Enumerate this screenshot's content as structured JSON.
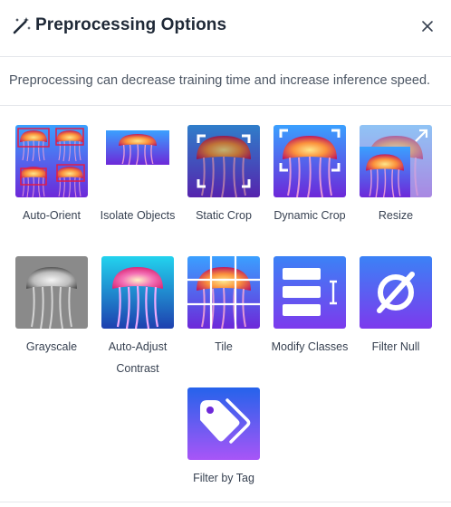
{
  "dialog": {
    "title": "Preprocessing Options",
    "subtitle": "Preprocessing can decrease training time and increase inference speed."
  },
  "options": [
    {
      "id": "auto-orient",
      "label": "Auto-Orient",
      "icon": "auto-orient-thumbnail"
    },
    {
      "id": "isolate-objects",
      "label": "Isolate Objects",
      "icon": "isolate-objects-thumbnail"
    },
    {
      "id": "static-crop",
      "label": "Static Crop",
      "icon": "static-crop-thumbnail"
    },
    {
      "id": "dynamic-crop",
      "label": "Dynamic Crop",
      "icon": "dynamic-crop-thumbnail"
    },
    {
      "id": "resize",
      "label": "Resize",
      "icon": "resize-thumbnail"
    },
    {
      "id": "grayscale",
      "label": "Grayscale",
      "icon": "grayscale-thumbnail"
    },
    {
      "id": "auto-adjust-contrast",
      "label": "Auto-Adjust Contrast",
      "icon": "auto-adjust-contrast-thumbnail"
    },
    {
      "id": "tile",
      "label": "Tile",
      "icon": "tile-thumbnail"
    },
    {
      "id": "modify-classes",
      "label": "Modify Classes",
      "icon": "modify-classes-icon"
    },
    {
      "id": "filter-null",
      "label": "Filter Null",
      "icon": "filter-null-icon"
    },
    {
      "id": "filter-by-tag",
      "label": "Filter by Tag",
      "icon": "tag-icon"
    }
  ],
  "colors": {
    "accent_gradient_top": "#3b82f6",
    "accent_gradient_bottom": "#7c3aed",
    "jelly_orange": "#f97316",
    "jelly_pink": "#ec4899",
    "tile_blue": "#2563eb"
  }
}
